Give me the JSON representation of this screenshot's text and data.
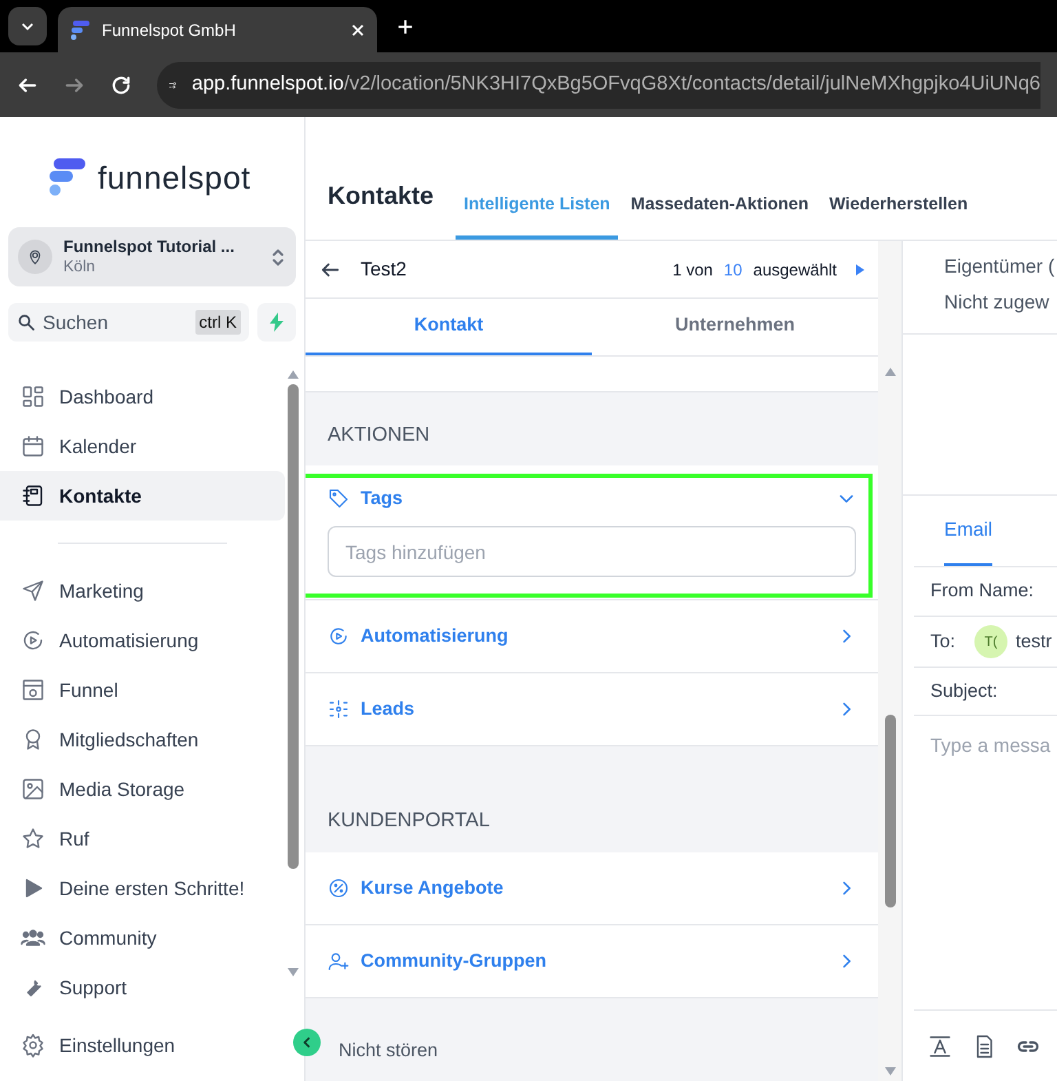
{
  "browser": {
    "tab_title": "Funnelspot GmbH",
    "url_host": "app.funnelspot.io",
    "url_path": "/v2/location/5NK3HI7QxBg5OFvqG8Xt/contacts/detail/julNeMXhgpjko4UiUNq6"
  },
  "sidebar": {
    "logo": "funnelspot",
    "account": {
      "name": "Funnelspot Tutorial ...",
      "city": "Köln"
    },
    "search": {
      "placeholder": "Suchen",
      "shortcut": "ctrl K"
    },
    "items": [
      {
        "label": "Dashboard",
        "kind": "grid",
        "selected": false
      },
      {
        "label": "Kalender",
        "kind": "calendar",
        "selected": false
      },
      {
        "label": "Kontakte",
        "kind": "notebook",
        "selected": true
      },
      {
        "kind": "divider"
      },
      {
        "label": "Marketing",
        "kind": "send",
        "selected": false
      },
      {
        "label": "Automatisierung",
        "kind": "play",
        "selected": false
      },
      {
        "label": "Funnel",
        "kind": "web",
        "selected": false
      },
      {
        "label": "Mitgliedschaften",
        "kind": "award",
        "selected": false
      },
      {
        "label": "Media Storage",
        "kind": "image",
        "selected": false
      },
      {
        "label": "Ruf",
        "kind": "star",
        "selected": false
      },
      {
        "label": "Deine ersten Schritte!",
        "kind": "triangle",
        "selected": false
      },
      {
        "label": "Community",
        "kind": "people",
        "selected": false
      },
      {
        "label": "Support",
        "kind": "wrench",
        "selected": false
      }
    ],
    "settings": "Einstellungen"
  },
  "header": {
    "title": "Kontakte",
    "tabs": [
      {
        "label": "Intelligente Listen",
        "selected": true
      },
      {
        "label": "Massedaten-Aktionen",
        "selected": false
      },
      {
        "label": "Wiederherstellen",
        "selected": false
      }
    ]
  },
  "contact": {
    "name": "Test2",
    "position": "1 von",
    "total": "10",
    "suffix": "ausgewählt",
    "tabs": [
      {
        "label": "Kontakt",
        "selected": true
      },
      {
        "label": "Unternehmen",
        "selected": false
      }
    ],
    "sections": [
      {
        "title": "AKTIONEN",
        "rows": [
          {
            "label": "Tags",
            "kind": "tag",
            "expanded": true,
            "highlighted": true,
            "placeholder": "Tags hinzufügen"
          },
          {
            "label": "Automatisierung",
            "kind": "play",
            "expanded": false,
            "highlighted": false
          },
          {
            "label": "Leads",
            "kind": "nodes",
            "expanded": false,
            "highlighted": false
          }
        ]
      },
      {
        "title": "KUNDENPORTAL",
        "rows": [
          {
            "label": "Kurse Angebote",
            "kind": "percent",
            "expanded": false,
            "highlighted": false
          },
          {
            "label": "Community-Gruppen",
            "kind": "user-plus",
            "expanded": false,
            "highlighted": false
          }
        ]
      }
    ],
    "footer": "Nicht stören"
  },
  "right": {
    "owner_label": "Eigentümer (",
    "owner_value": "Nicht zugew",
    "tab": "Email",
    "from_label": "From Name:",
    "to_label": "To:",
    "to_avatar": "T(",
    "to_value": "testr",
    "subject_label": "Subject:",
    "message_placeholder": "Type a messa"
  }
}
